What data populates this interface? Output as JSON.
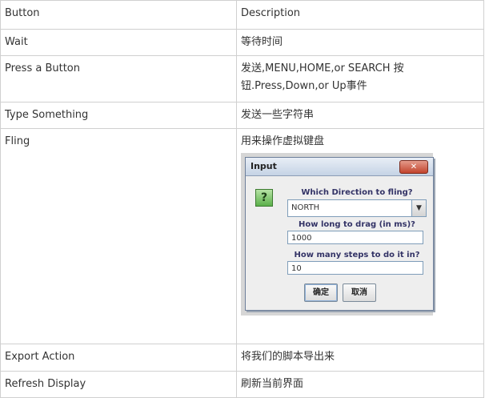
{
  "table": {
    "header": [
      "Button",
      "Description"
    ],
    "rows": [
      {
        "button": "Wait",
        "description": "等待时间"
      },
      {
        "button": "Press a Button",
        "description": "发送,MENU,HOME,or SEARCH 按钮.Press,Down,or Up事件"
      },
      {
        "button": "Type Something",
        "description": "发送一些字符串"
      },
      {
        "button": "Fling",
        "description": "用来操作虚拟键盘"
      },
      {
        "button": "Export Action",
        "description": "将我们的脚本导出来"
      },
      {
        "button": "Refresh Display",
        "description": "刷新当前界面"
      }
    ]
  },
  "dialog": {
    "title": "Input",
    "close_glyph": "✕",
    "icon": "question-icon",
    "icon_glyph": "?",
    "direction_label": "Which Direction to fling?",
    "direction_value": "NORTH",
    "drag_label": "How long to drag (in ms)?",
    "drag_value": "1000",
    "steps_label": "How many steps to do it in?",
    "steps_value": "10",
    "ok_label": "确定",
    "cancel_label": "取消"
  },
  "colors": {
    "grid_border": "#d0d0d0",
    "text": "#333333",
    "dialog_label": "#333366",
    "close_button": "#c2442d",
    "question_icon": "#5bb04a"
  }
}
